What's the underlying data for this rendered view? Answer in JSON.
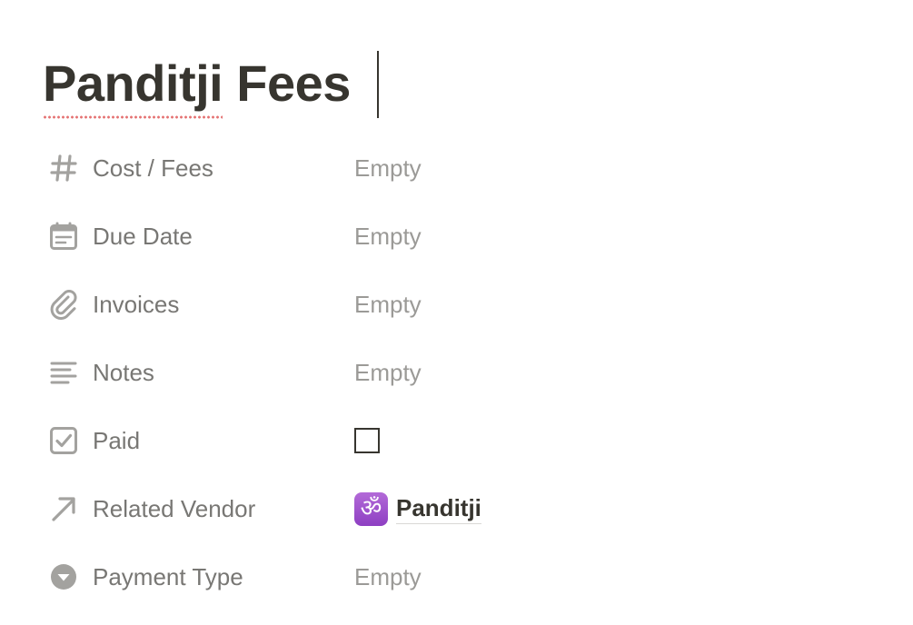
{
  "page": {
    "title_first_word": "Panditji",
    "title_rest": " Fees"
  },
  "properties": [
    {
      "icon": "number-icon",
      "name": "Cost / Fees",
      "type": "number",
      "value": "Empty"
    },
    {
      "icon": "calendar-icon",
      "name": "Due Date",
      "type": "date",
      "value": "Empty"
    },
    {
      "icon": "paperclip-icon",
      "name": "Invoices",
      "type": "files",
      "value": "Empty"
    },
    {
      "icon": "text-lines-icon",
      "name": "Notes",
      "type": "text",
      "value": "Empty"
    },
    {
      "icon": "checkbox-icon",
      "name": "Paid",
      "type": "checkbox",
      "checked": false
    },
    {
      "icon": "arrow-up-right-icon",
      "name": "Related Vendor",
      "type": "relation",
      "value": "Panditji",
      "value_icon": "om-emoji"
    },
    {
      "icon": "select-icon",
      "name": "Payment Type",
      "type": "select",
      "value": "Empty"
    }
  ],
  "colors": {
    "title": "#37352f",
    "label": "#787774",
    "empty": "#9b9a97",
    "icon": "#a3a29f",
    "spellcheck": "#e57373",
    "om_badge": "#9b4dca"
  }
}
